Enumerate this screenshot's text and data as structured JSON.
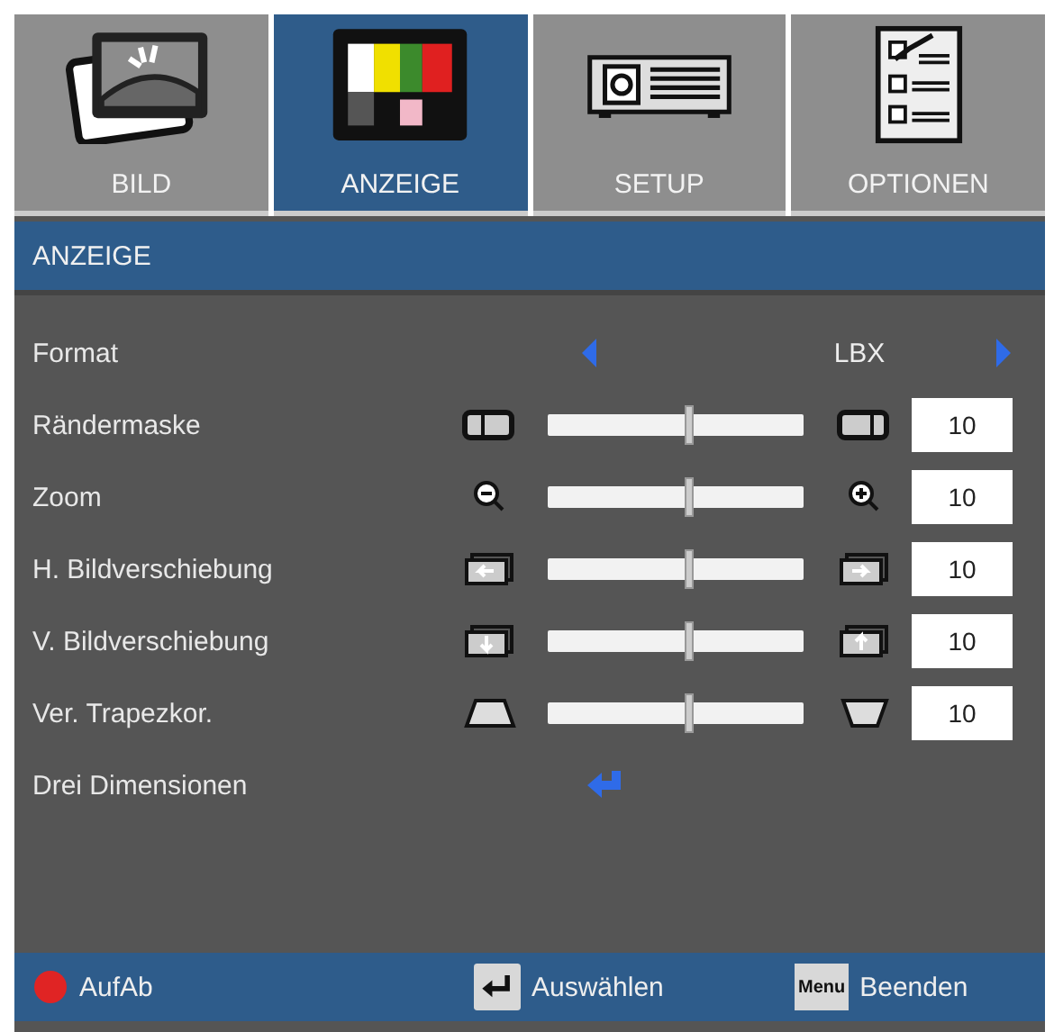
{
  "tabs": [
    {
      "label": "BILD",
      "selected": false
    },
    {
      "label": "ANZEIGE",
      "selected": true
    },
    {
      "label": "SETUP",
      "selected": false
    },
    {
      "label": "OPTIONEN",
      "selected": false
    }
  ],
  "section_title": "ANZEIGE",
  "rows": [
    {
      "kind": "select",
      "label": "Format",
      "value": "LBX"
    },
    {
      "kind": "slider",
      "label": "Rändermaske",
      "level": 0.55,
      "value": "10"
    },
    {
      "kind": "slider",
      "label": "Zoom",
      "level": 0.55,
      "value": "10"
    },
    {
      "kind": "slider",
      "label": "H. Bildverschiebung",
      "level": 0.55,
      "value": "10"
    },
    {
      "kind": "slider",
      "label": "V. Bildverschiebung",
      "level": 0.55,
      "value": "10"
    },
    {
      "kind": "slider",
      "label": "Ver. Trapezkor.",
      "level": 0.55,
      "value": "10"
    },
    {
      "kind": "enter",
      "label": "Drei Dimensionen"
    }
  ],
  "footer": [
    {
      "kind": "updown",
      "label": "AufAb"
    },
    {
      "kind": "enter",
      "label": "Auswählen"
    },
    {
      "kind": "menu",
      "key": "Menu",
      "label": "Beenden"
    }
  ]
}
